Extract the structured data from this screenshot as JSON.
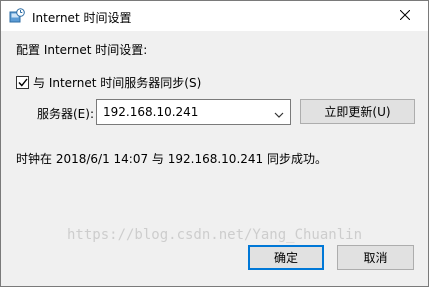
{
  "window": {
    "title": "Internet 时间设置",
    "icon": "clock-globe-icon",
    "close_glyph": "✕"
  },
  "content": {
    "heading": "配置 Internet 时间设置:",
    "sync_checkbox": {
      "label": "与 Internet 时间服务器同步(S)",
      "checked": true
    },
    "server": {
      "label": "服务器(E):",
      "value": "192.168.10.241"
    },
    "update_button": "立即更新(U)",
    "status_text": "时钟在 2018/6/1 14:07 与 192.168.10.241 同步成功。"
  },
  "footer": {
    "ok_button": "确定",
    "cancel_button": "取消"
  },
  "watermark": "https://blog.csdn.net/Yang_Chuanlin"
}
